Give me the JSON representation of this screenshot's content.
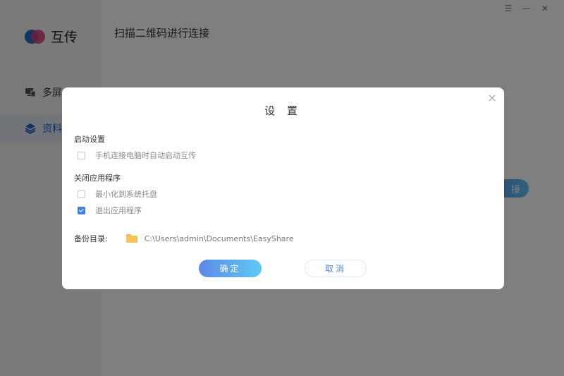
{
  "app": {
    "name": "互传",
    "main_title": "扫描二维码进行连接",
    "connect_label": "接"
  },
  "sidebar": {
    "items": [
      {
        "label": "多屏"
      },
      {
        "label": "资料"
      }
    ]
  },
  "window_controls": {
    "menu": "☰",
    "minimize": "—",
    "close": "✕"
  },
  "dialog": {
    "title": "设 置",
    "close_glyph": "×",
    "startup": {
      "title": "启动设置",
      "options": [
        {
          "label": "手机连接电脑时自动启动互传",
          "checked": false
        }
      ]
    },
    "on_close": {
      "title": "关闭应用程序",
      "options": [
        {
          "label": "最小化到系统托盘",
          "checked": false
        },
        {
          "label": "退出应用程序",
          "checked": true
        }
      ]
    },
    "backup": {
      "label": "备份目录:",
      "path": "C:\\Users\\admin\\Documents\\EasyShare"
    },
    "confirm_label": "确定",
    "cancel_label": "取消"
  },
  "colors": {
    "accent": "#3f7fe6",
    "overlay": "#000000",
    "folder": "#f8c25a"
  }
}
